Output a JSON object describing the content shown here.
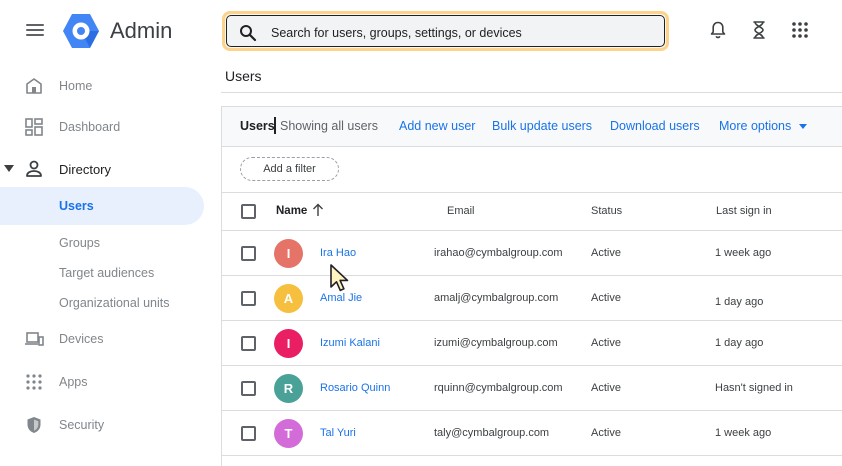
{
  "app": {
    "title": "Admin"
  },
  "search": {
    "placeholder": "Search for users, groups, settings, or devices"
  },
  "sidebar": {
    "items": [
      {
        "label": "Home",
        "icon": "home-icon"
      },
      {
        "label": "Dashboard",
        "icon": "dashboard-icon"
      },
      {
        "label": "Directory",
        "icon": "person-icon"
      },
      {
        "label": "Users"
      },
      {
        "label": "Groups"
      },
      {
        "label": "Target audiences"
      },
      {
        "label": "Organizational units"
      },
      {
        "label": "Devices",
        "icon": "devices-icon"
      },
      {
        "label": "Apps",
        "icon": "apps-icon"
      },
      {
        "label": "Security",
        "icon": "shield-icon"
      }
    ]
  },
  "main": {
    "page_title": "Users",
    "toolbar": {
      "users_label": "Users",
      "showing": "Showing all users",
      "add_user": "Add new user",
      "bulk_update": "Bulk update users",
      "download": "Download users",
      "more_options": "More options"
    },
    "filter": {
      "label": "Add a filter"
    },
    "table": {
      "columns": [
        "Name",
        "Email",
        "Status",
        "Last sign in"
      ],
      "rows": [
        {
          "initial": "I",
          "name": "Ira Hao",
          "email": "irahao@cymbalgroup.com",
          "status": "Active",
          "last_sign_in": "1 week ago",
          "color": "#e57368"
        },
        {
          "initial": "A",
          "name": "Amal Jie",
          "email": "amalj@cymbalgroup.com",
          "status": "Active",
          "last_sign_in": "1 day ago",
          "color": "#f6bf3d"
        },
        {
          "initial": "I",
          "name": "Izumi Kalani",
          "email": "izumi@cymbalgroup.com",
          "status": "Active",
          "last_sign_in": "1 day ago",
          "color": "#e91e63"
        },
        {
          "initial": "R",
          "name": "Rosario Quinn",
          "email": "rquinn@cymbalgroup.com",
          "status": "Active",
          "last_sign_in": "Hasn't signed in",
          "color": "#4aa197"
        },
        {
          "initial": "T",
          "name": "Tal Yuri",
          "email": "taly@cymbalgroup.com",
          "status": "Active",
          "last_sign_in": "1 week ago",
          "color": "#d36bd8"
        }
      ]
    }
  },
  "colors": {
    "accent": "#1a73e8",
    "active_nav_bg": "#e8f0fe",
    "search_highlight": "#fbd38d"
  }
}
